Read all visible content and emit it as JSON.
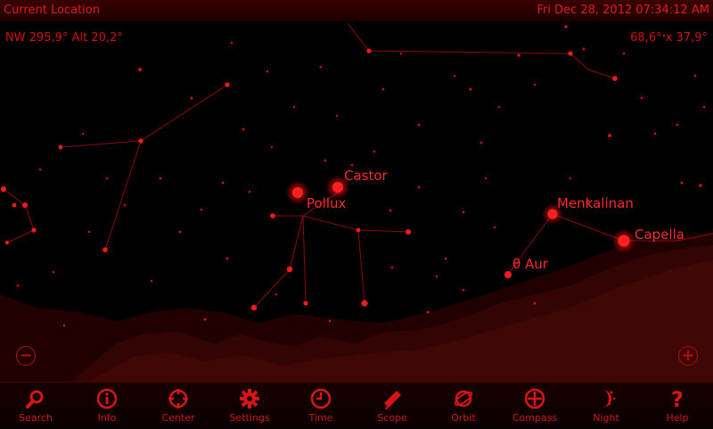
{
  "topbar": {
    "location": "Current Location",
    "datetime": "Fri Dec 28, 2012  07:34:12 AM"
  },
  "sky": {
    "direction_altitude": "NW 295,9°  Alt 20,2°",
    "field_of_view": "68,6° x 37,9°",
    "star_labels": {
      "castor": "Castor",
      "pollux": "Pollux",
      "menkalinan": "Menkalinan",
      "capella": "Capella",
      "theta_aur": "θ Aur"
    }
  },
  "zoom": {
    "out_icon": "zoom-out-icon",
    "in_icon": "zoom-in-icon"
  },
  "toolbar": {
    "search": "Search",
    "info": "Info",
    "center": "Center",
    "settings": "Settings",
    "time": "Time",
    "scope": "Scope",
    "orbit": "Orbit",
    "compass": "Compass",
    "night": "Night",
    "help": "Help"
  },
  "colors": {
    "accent": "#e01010",
    "background": "#000000",
    "bar": "#2a0000"
  }
}
